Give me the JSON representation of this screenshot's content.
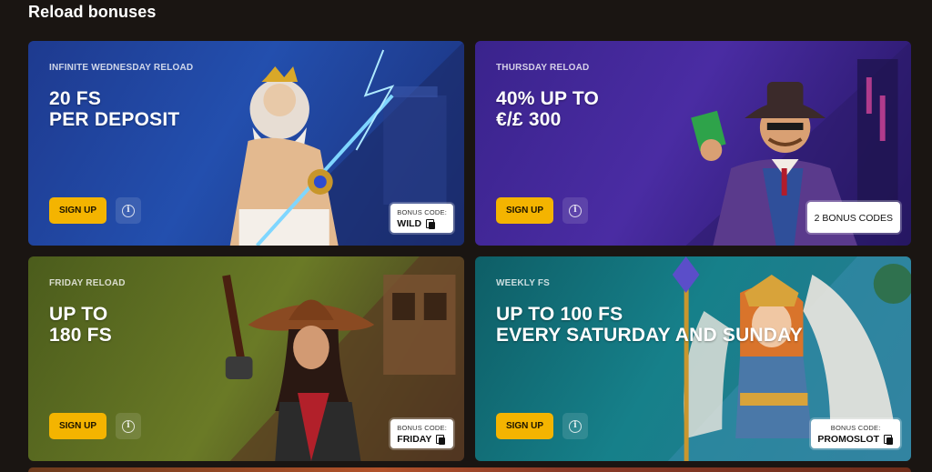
{
  "section": {
    "title": "Reload bonuses"
  },
  "cards": [
    {
      "eyebrow": "INFINITE WEDNESDAY RELOAD",
      "headline": [
        "20 FS",
        "PER DEPOSIT"
      ],
      "signup_label": "SIGN UP",
      "info_glyph": "i",
      "code_label": "BONUS CODE:",
      "code_value": "WILD",
      "art_icon": "zeus-character-illustration"
    },
    {
      "eyebrow": "THURSDAY RELOAD",
      "headline": [
        "40% UP TO",
        "€/£ 300"
      ],
      "signup_label": "SIGN UP",
      "info_glyph": "i",
      "code_value": "2 BONUS CODES",
      "art_icon": "gentleman-with-cash-illustration"
    },
    {
      "eyebrow": "FRIDAY RELOAD",
      "headline": [
        "UP TO",
        "180 FS"
      ],
      "signup_label": "SIGN UP",
      "info_glyph": "i",
      "code_label": "BONUS CODE:",
      "code_value": "FRIDAY",
      "art_icon": "cowgirl-gunslinger-illustration"
    },
    {
      "eyebrow": "WEEKLY FS",
      "headline": [
        "UP TO 100 FS",
        "EVERY SATURDAY AND SUNDAY"
      ],
      "signup_label": "SIGN UP",
      "info_glyph": "i",
      "code_label": "BONUS CODE:",
      "code_value": "PROMOSLOT",
      "art_icon": "valkyrie-warrior-illustration"
    }
  ],
  "colors": {
    "signup_button": "#f4b400",
    "card_wednesday": "#234fae",
    "card_thursday": "#4a2ca3",
    "card_friday": "#6a7a26",
    "card_weekly": "#16808a",
    "page_background": "#1a1512"
  }
}
